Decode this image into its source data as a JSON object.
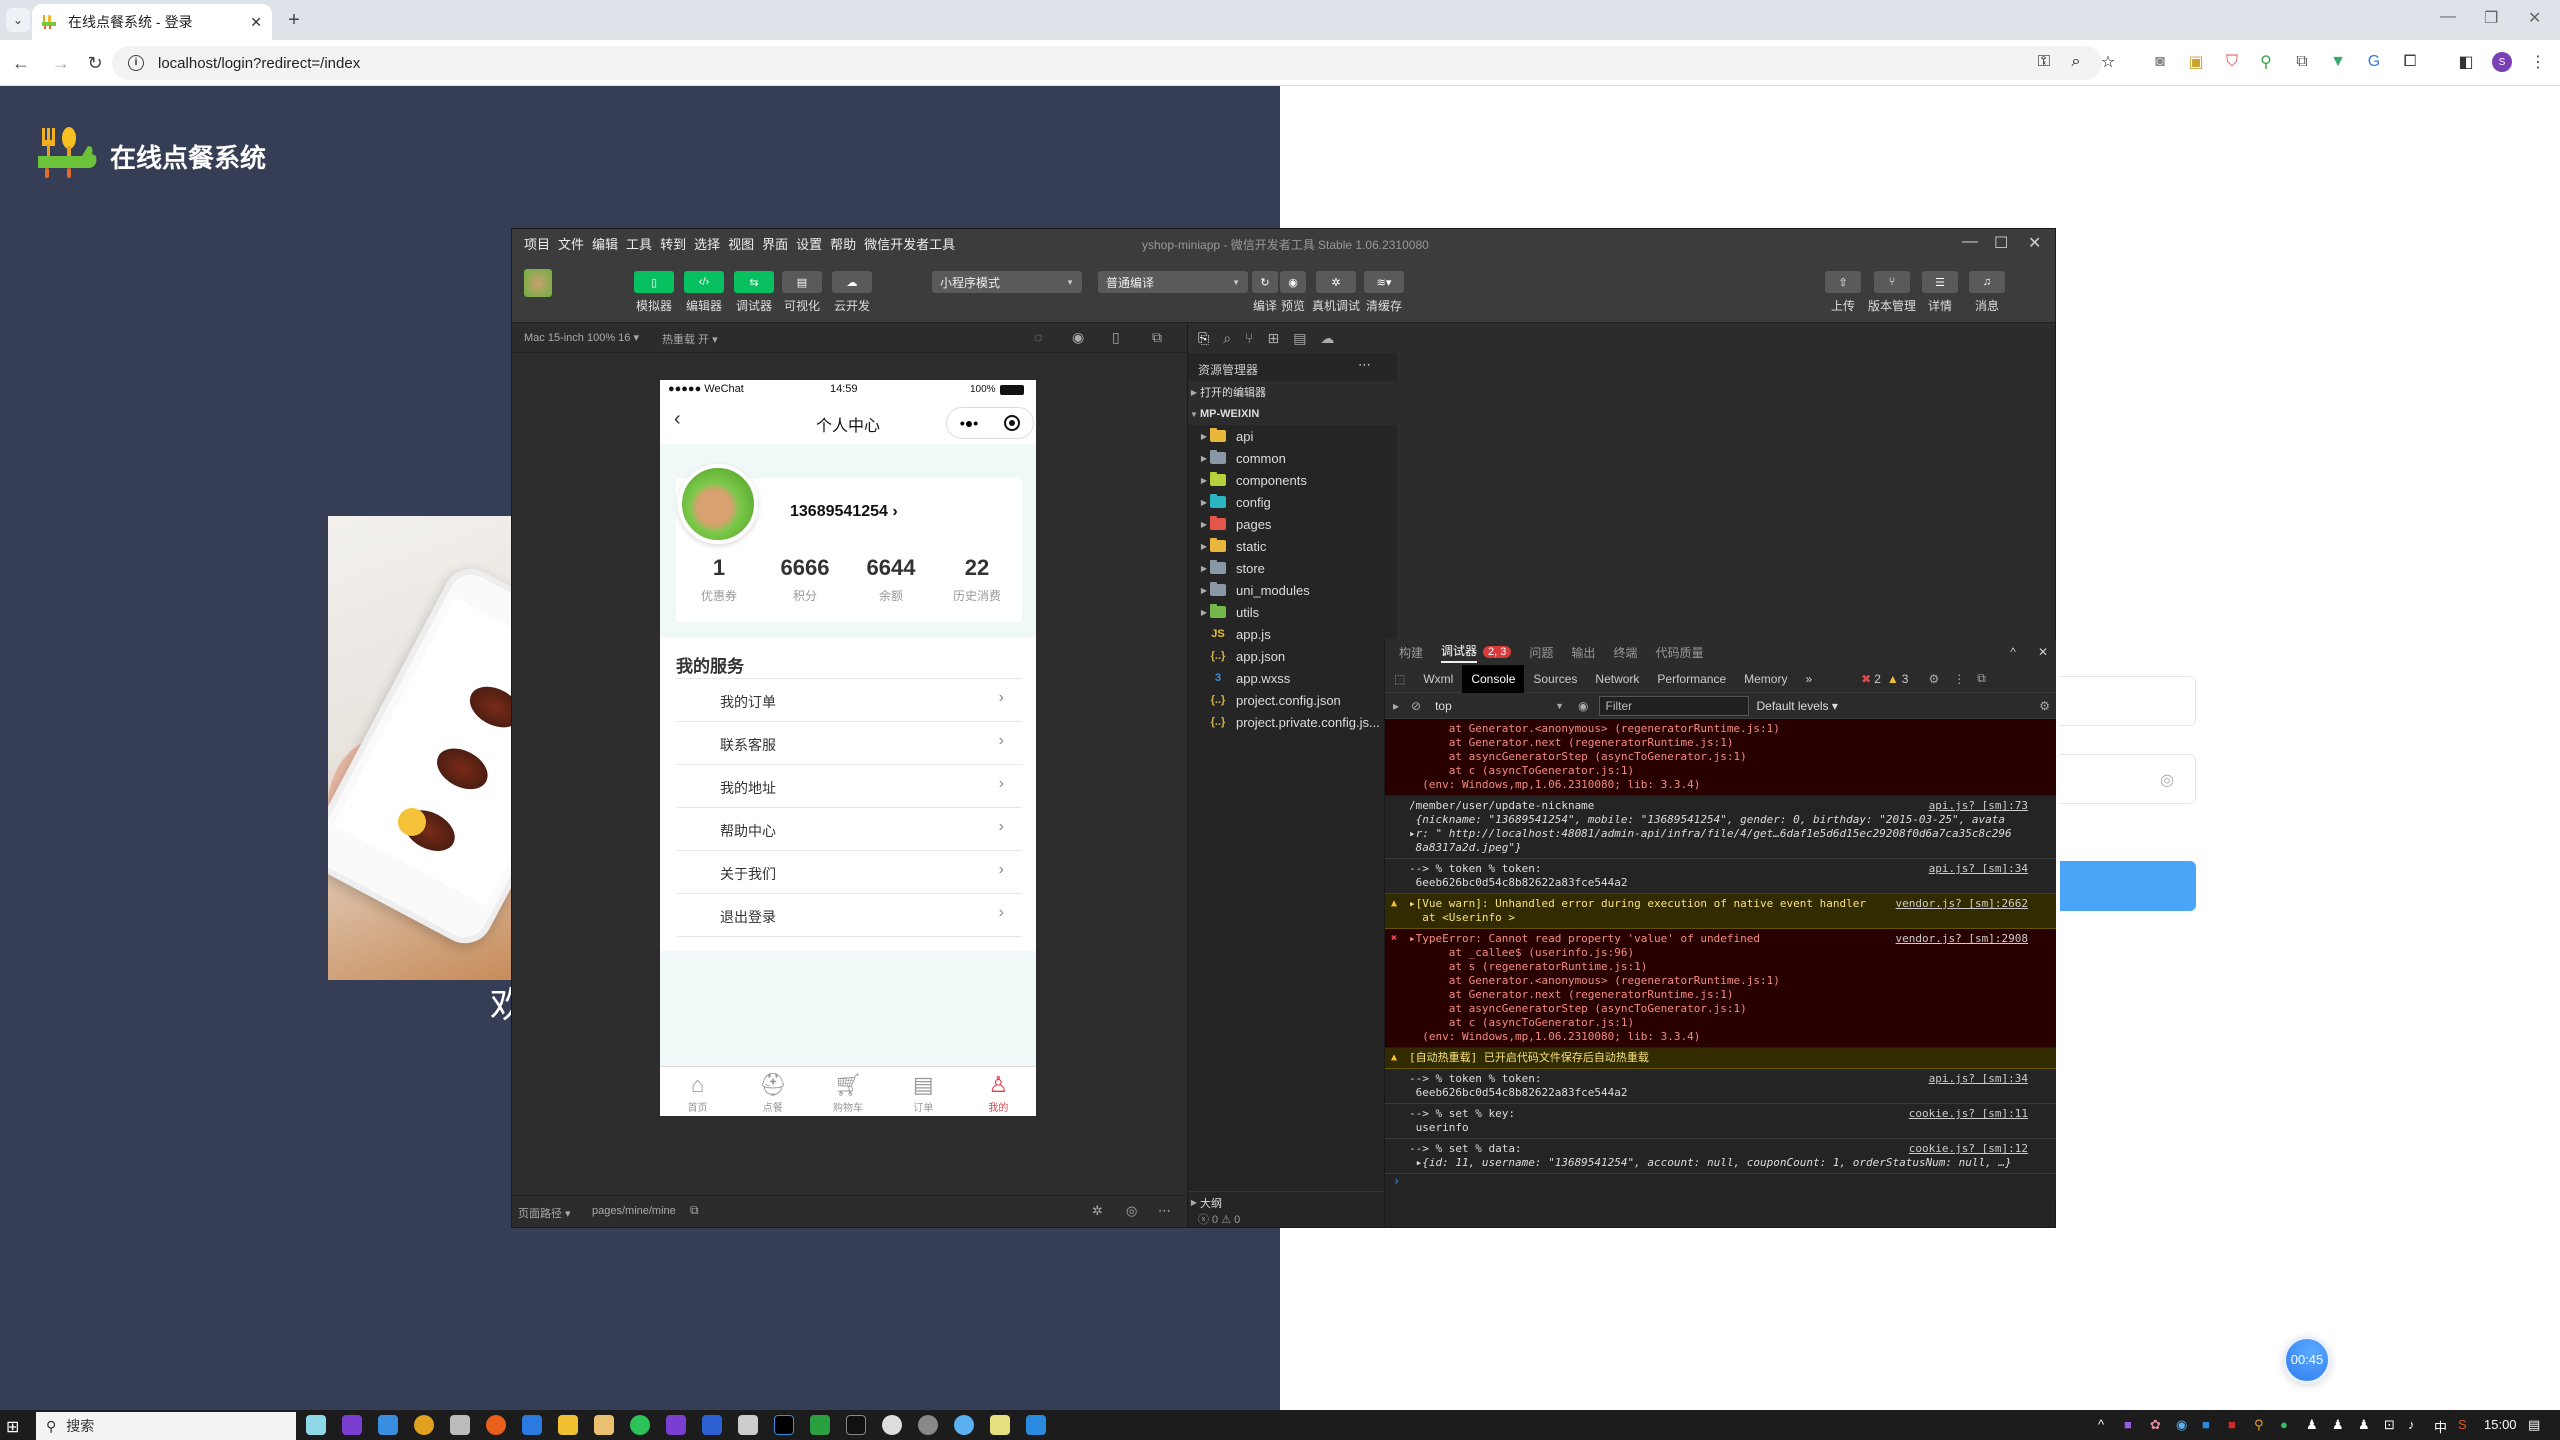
{
  "browser": {
    "tab_title": "在线点餐系统 - 登录",
    "url": "localhost/login?redirect=/index",
    "profile_initial": "S"
  },
  "page": {
    "brand": "在线点餐系统",
    "welcome_partial": "欢",
    "timer": "00:45",
    "accent": "#4aa5f8"
  },
  "ide": {
    "menu": [
      "项目",
      "文件",
      "编辑",
      "工具",
      "转到",
      "选择",
      "视图",
      "界面",
      "设置",
      "帮助",
      "微信开发者工具"
    ],
    "title": "yshop-miniapp - 微信开发者工具 Stable 1.06.2310080",
    "toolbar_left": [
      {
        "label": "模拟器",
        "icon": "phone-icon"
      },
      {
        "label": "编辑器",
        "icon": "code-icon"
      },
      {
        "label": "调试器",
        "icon": "debug-icon"
      },
      {
        "label": "可视化",
        "icon": "layout-icon"
      },
      {
        "label": "云开发",
        "icon": "cloud-icon"
      }
    ],
    "mode_select": "小程序模式",
    "compile_select": "普通编译",
    "toolbar_mid": [
      "编译",
      "预览",
      "真机调试",
      "清缓存"
    ],
    "toolbar_right": [
      "上传",
      "版本管理",
      "详情",
      "消息"
    ],
    "sim_device": "Mac 15-inch 100% 16 ▾",
    "hot_reload": "热重载 开 ▾",
    "page_path_label": "页面路径 ▾",
    "page_path": "pages/mine/mine",
    "explorer": {
      "title": "资源管理器",
      "open_editors": "打开的编辑器",
      "root": "MP-WEIXIN",
      "folders": [
        {
          "name": "api",
          "color": "#e8b63a"
        },
        {
          "name": "common",
          "color": "#8a97a6"
        },
        {
          "name": "components",
          "color": "#b7d13c"
        },
        {
          "name": "config",
          "color": "#2ab3c0"
        },
        {
          "name": "pages",
          "color": "#e5564a"
        },
        {
          "name": "static",
          "color": "#e8b63a"
        },
        {
          "name": "store",
          "color": "#8a97a6"
        },
        {
          "name": "uni_modules",
          "color": "#8a97a6"
        },
        {
          "name": "utils",
          "color": "#74b84a"
        }
      ],
      "files": [
        {
          "name": "app.js",
          "icon": "JS",
          "color": "#e6c229"
        },
        {
          "name": "app.json",
          "icon": "{..}",
          "color": "#d6b24a"
        },
        {
          "name": "app.wxss",
          "icon": "3",
          "color": "#3a8fd6"
        },
        {
          "name": "project.config.json",
          "icon": "{..}",
          "color": "#d6b24a"
        },
        {
          "name": "project.private.config.js...",
          "icon": "{..}",
          "color": "#d6b24a"
        }
      ],
      "outline": "大纲",
      "problems": "ⓧ 0 ⚠ 0"
    },
    "debugger": {
      "top_tabs": [
        "构建",
        "调试器",
        "问题",
        "输出",
        "终端",
        "代码质量"
      ],
      "badge": "2, 3",
      "devtools_tabs": [
        "Wxml",
        "Console",
        "Sources",
        "Network",
        "Performance",
        "Memory"
      ],
      "error_count": "2",
      "warn_count": "3",
      "context": "top",
      "filter_placeholder": "Filter",
      "levels": "Default levels ▾"
    }
  },
  "console": [
    {
      "type": "err-cont",
      "lines": [
        "      at Generator.<anonymous> (regeneratorRuntime.js:1)",
        "      at Generator.next (regeneratorRuntime.js:1)",
        "      at asyncGeneratorStep (asyncToGenerator.js:1)",
        "      at c (asyncToGenerator.js:1)",
        "  (env: Windows,mp,1.06.2310080; lib: 3.3.4)"
      ]
    },
    {
      "type": "log",
      "src": "api.js? [sm]:73",
      "lines": [
        "/member/user/update-nickname",
        " {nickname: \"13689541254\", mobile: \"13689541254\", gender: 0, birthday: \"2015-03-25\", avata",
        "▸r: \" http://localhost:48081/admin-api/infra/file/4/get…6daf1e5d6d15ec29208f0d6a7ca35c8c296",
        " 8a8317a2d.jpeg\"}"
      ]
    },
    {
      "type": "log",
      "src": "api.js? [sm]:34",
      "lines": [
        "--> % token % token:",
        " 6eeb626bc0d54c8b82622a83fce544a2"
      ]
    },
    {
      "type": "warn",
      "src": "vendor.js? [sm]:2662",
      "lines": [
        "▸[Vue warn]: Unhandled error during execution of native event handler",
        "  at <Userinfo >"
      ]
    },
    {
      "type": "err",
      "src": "vendor.js? [sm]:2908",
      "lines": [
        "▸TypeError: Cannot read property 'value' of undefined",
        "      at _callee$ (userinfo.js:96)",
        "      at s (regeneratorRuntime.js:1)",
        "      at Generator.<anonymous> (regeneratorRuntime.js:1)",
        "      at Generator.next (regeneratorRuntime.js:1)",
        "      at asyncGeneratorStep (asyncToGenerator.js:1)",
        "      at c (asyncToGenerator.js:1)",
        "  (env: Windows,mp,1.06.2310080; lib: 3.3.4)"
      ]
    },
    {
      "type": "warn",
      "src": "",
      "lines": [
        "[自动热重载] 已开启代码文件保存后自动热重载"
      ]
    },
    {
      "type": "log",
      "src": "api.js? [sm]:34",
      "lines": [
        "--> % token % token:",
        " 6eeb626bc0d54c8b82622a83fce544a2"
      ]
    },
    {
      "type": "log",
      "src": "cookie.js? [sm]:11",
      "lines": [
        "--> % set % key:",
        " userinfo"
      ]
    },
    {
      "type": "log",
      "src": "cookie.js? [sm]:12",
      "lines": [
        "--> % set % data:",
        " ▸{id: 11, username: \"13689541254\", account: null, couponCount: 1, orderStatusNum: null, …}"
      ]
    }
  ],
  "phone": {
    "carrier": "●●●●● WeChat",
    "time": "14:59",
    "battery": "100%",
    "title": "个人中心",
    "username": "13689541254 ›",
    "stats": [
      {
        "value": "1",
        "label": "优惠券"
      },
      {
        "value": "6666",
        "label": "积分"
      },
      {
        "value": "6644",
        "label": "余额"
      },
      {
        "value": "22",
        "label": "历史消费"
      }
    ],
    "services_title": "我的服务",
    "services": [
      "我的订单",
      "联系客服",
      "我的地址",
      "帮助中心",
      "关于我们",
      "退出登录"
    ],
    "tabs": [
      {
        "label": "首页",
        "icon": "home-icon",
        "active": false
      },
      {
        "label": "点餐",
        "icon": "cloche-icon",
        "active": false
      },
      {
        "label": "购物车",
        "icon": "cart-icon",
        "active": false
      },
      {
        "label": "订单",
        "icon": "order-icon",
        "active": false
      },
      {
        "label": "我的",
        "icon": "user-icon",
        "active": true
      }
    ],
    "active_color": "#d9434d"
  },
  "taskbar": {
    "search": "搜索",
    "time": "15:00",
    "ime": "中"
  }
}
